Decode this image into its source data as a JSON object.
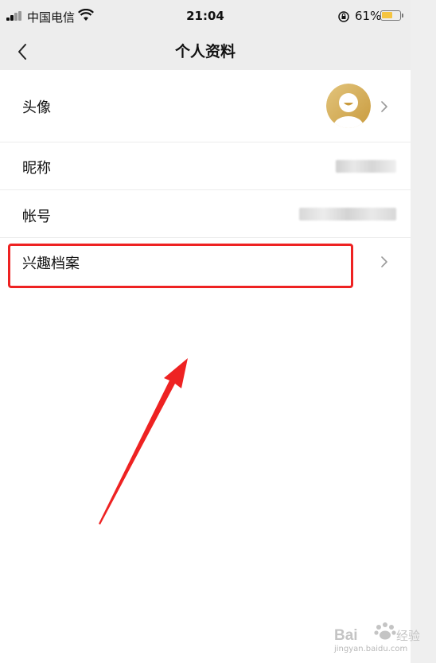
{
  "status_bar": {
    "carrier": "中国电信",
    "time": "21:04",
    "battery_text": "61%",
    "battery_level": 0.61,
    "battery_color": "#f5c542"
  },
  "nav": {
    "title": "个人资料",
    "back_icon": "chevron-left-icon"
  },
  "profile_rows": {
    "avatar": {
      "label": "头像",
      "avatar_color": "#d7b15a"
    },
    "nickname": {
      "label": "昵称"
    },
    "account": {
      "label": "帐号"
    },
    "interest": {
      "label": "兴趣档案"
    }
  },
  "annotation": {
    "box_color": "#ee2222",
    "arrow_color": "#ee2222"
  },
  "watermark": {
    "brand": "Bai",
    "suffix": "经验",
    "url": "jingyan.baidu.com"
  }
}
